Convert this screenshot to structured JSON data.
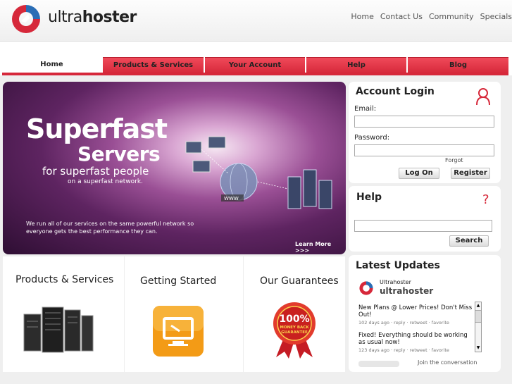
{
  "header": {
    "logo_light": "ultra",
    "logo_bold": "hoster",
    "nav": [
      "Home",
      "Contact Us",
      "Community",
      "Specials"
    ]
  },
  "tabs": [
    "Home",
    "Products & Services",
    "Your Account",
    "Help",
    "Blog"
  ],
  "hero": {
    "title_line1": "Superfast",
    "title_line2": "Servers",
    "subtitle": "for superfast people",
    "subtitle2": "on a superfast network.",
    "description": "We run all of our services on the same powerful network so everyone gets the best performance they can.",
    "more_link": "Learn More >>>",
    "www_label": "WWW"
  },
  "login": {
    "title": "Account Login",
    "email_label": "Email:",
    "password_label": "Password:",
    "forgot_link": "Forgot Password?",
    "logon_button": "Log On",
    "register_button": "Register"
  },
  "help": {
    "title": "Help",
    "search_button": "Search"
  },
  "updates": {
    "title": "Latest Updates",
    "account_name": "Ultrahoster",
    "account_handle": "ultrahoster",
    "tweets": [
      {
        "text": "New Plans @ Lower Prices! Don't Miss Out!",
        "meta": "102 days ago · reply · retweet · favorite"
      },
      {
        "text": "Fixed! Everything should be working as usual now!",
        "meta": "123 days ago · reply · retweet · favorite"
      }
    ],
    "join_link": "Join the conversation"
  },
  "columns": [
    "Products & Services",
    "Getting Started",
    "Our Guarantees"
  ],
  "badge": {
    "percent": "100%",
    "line1": "MONEY BACK",
    "line2": "GUARANTEE"
  },
  "colors": {
    "brand_red": "#d6283a",
    "tab_red": "#f04a5a",
    "hero_purple": "#5e2461"
  }
}
